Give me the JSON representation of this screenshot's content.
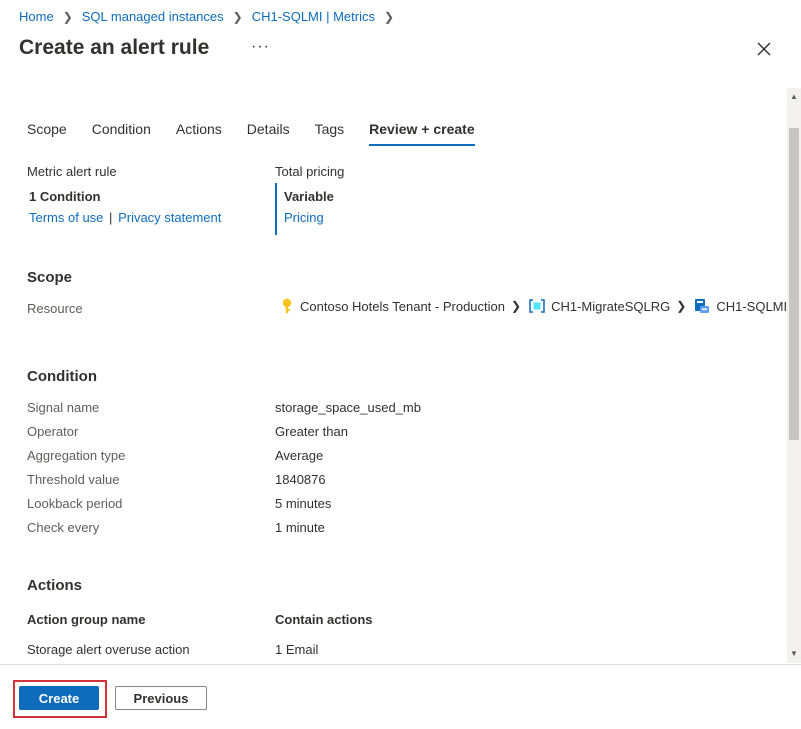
{
  "breadcrumb": [
    "Home",
    "SQL managed instances",
    "CH1-SQLMI | Metrics"
  ],
  "title": "Create an alert rule",
  "more_label": "···",
  "tabs": [
    {
      "label": "Scope"
    },
    {
      "label": "Condition"
    },
    {
      "label": "Actions"
    },
    {
      "label": "Details"
    },
    {
      "label": "Tags"
    },
    {
      "label": "Review + create",
      "active": true
    }
  ],
  "summary": {
    "rule_type": "Metric alert rule",
    "condition_count": "1 Condition",
    "terms_link": "Terms of use",
    "separator": "|",
    "privacy_link": "Privacy statement",
    "pricing_title": "Total pricing",
    "pricing_value": "Variable",
    "pricing_link": "Pricing"
  },
  "scope": {
    "heading": "Scope",
    "resource_label": "Resource",
    "path": [
      {
        "name": "Contoso Hotels Tenant - Production",
        "icon": "key-icon"
      },
      {
        "name": "CH1-MigrateSQLRG",
        "icon": "resource-group-icon"
      },
      {
        "name": "CH1-SQLMI",
        "icon": "sql-managed-instance-icon"
      }
    ]
  },
  "condition": {
    "heading": "Condition",
    "rows": [
      {
        "label": "Signal name",
        "value": "storage_space_used_mb"
      },
      {
        "label": "Operator",
        "value": "Greater than"
      },
      {
        "label": "Aggregation type",
        "value": "Average"
      },
      {
        "label": "Threshold value",
        "value": "1840876"
      },
      {
        "label": "Lookback period",
        "value": "5 minutes"
      },
      {
        "label": "Check every",
        "value": "1 minute"
      }
    ]
  },
  "actions": {
    "heading": "Actions",
    "col_group": "Action group name",
    "col_contain": "Contain actions",
    "rows": [
      {
        "group": "Storage alert overuse action",
        "contains": "1 Email"
      }
    ]
  },
  "footer": {
    "create_label": "Create",
    "previous_label": "Previous"
  },
  "colors": {
    "accent": "#0f6cbd",
    "highlight": "#d13438"
  }
}
